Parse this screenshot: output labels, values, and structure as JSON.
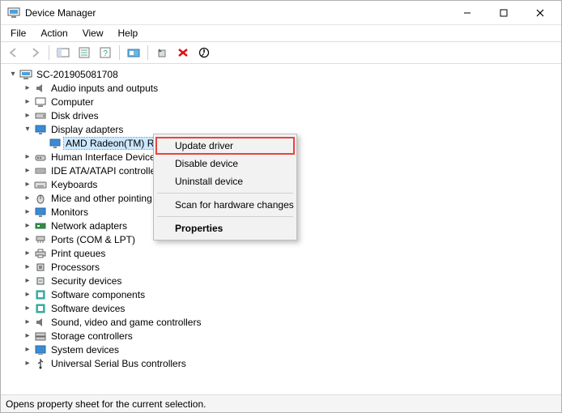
{
  "window": {
    "title": "Device Manager"
  },
  "menubar": {
    "file": "File",
    "action": "Action",
    "view": "View",
    "help": "Help"
  },
  "tree": {
    "root": "SC-201905081708",
    "items": [
      "Audio inputs and outputs",
      "Computer",
      "Disk drives",
      "Display adapters",
      "Human Interface Devices",
      "IDE ATA/ATAPI controllers",
      "Keyboards",
      "Mice and other pointing devices",
      "Monitors",
      "Network adapters",
      "Ports (COM & LPT)",
      "Print queues",
      "Processors",
      "Security devices",
      "Software components",
      "Software devices",
      "Sound, video and game controllers",
      "Storage controllers",
      "System devices",
      "Universal Serial Bus controllers"
    ],
    "display_child": "AMD Radeon(TM) RX Vega 11 Graphics"
  },
  "context_menu": {
    "update": "Update driver",
    "disable": "Disable device",
    "uninstall": "Uninstall device",
    "scan": "Scan for hardware changes",
    "properties": "Properties"
  },
  "statusbar": {
    "text": "Opens property sheet for the current selection."
  }
}
